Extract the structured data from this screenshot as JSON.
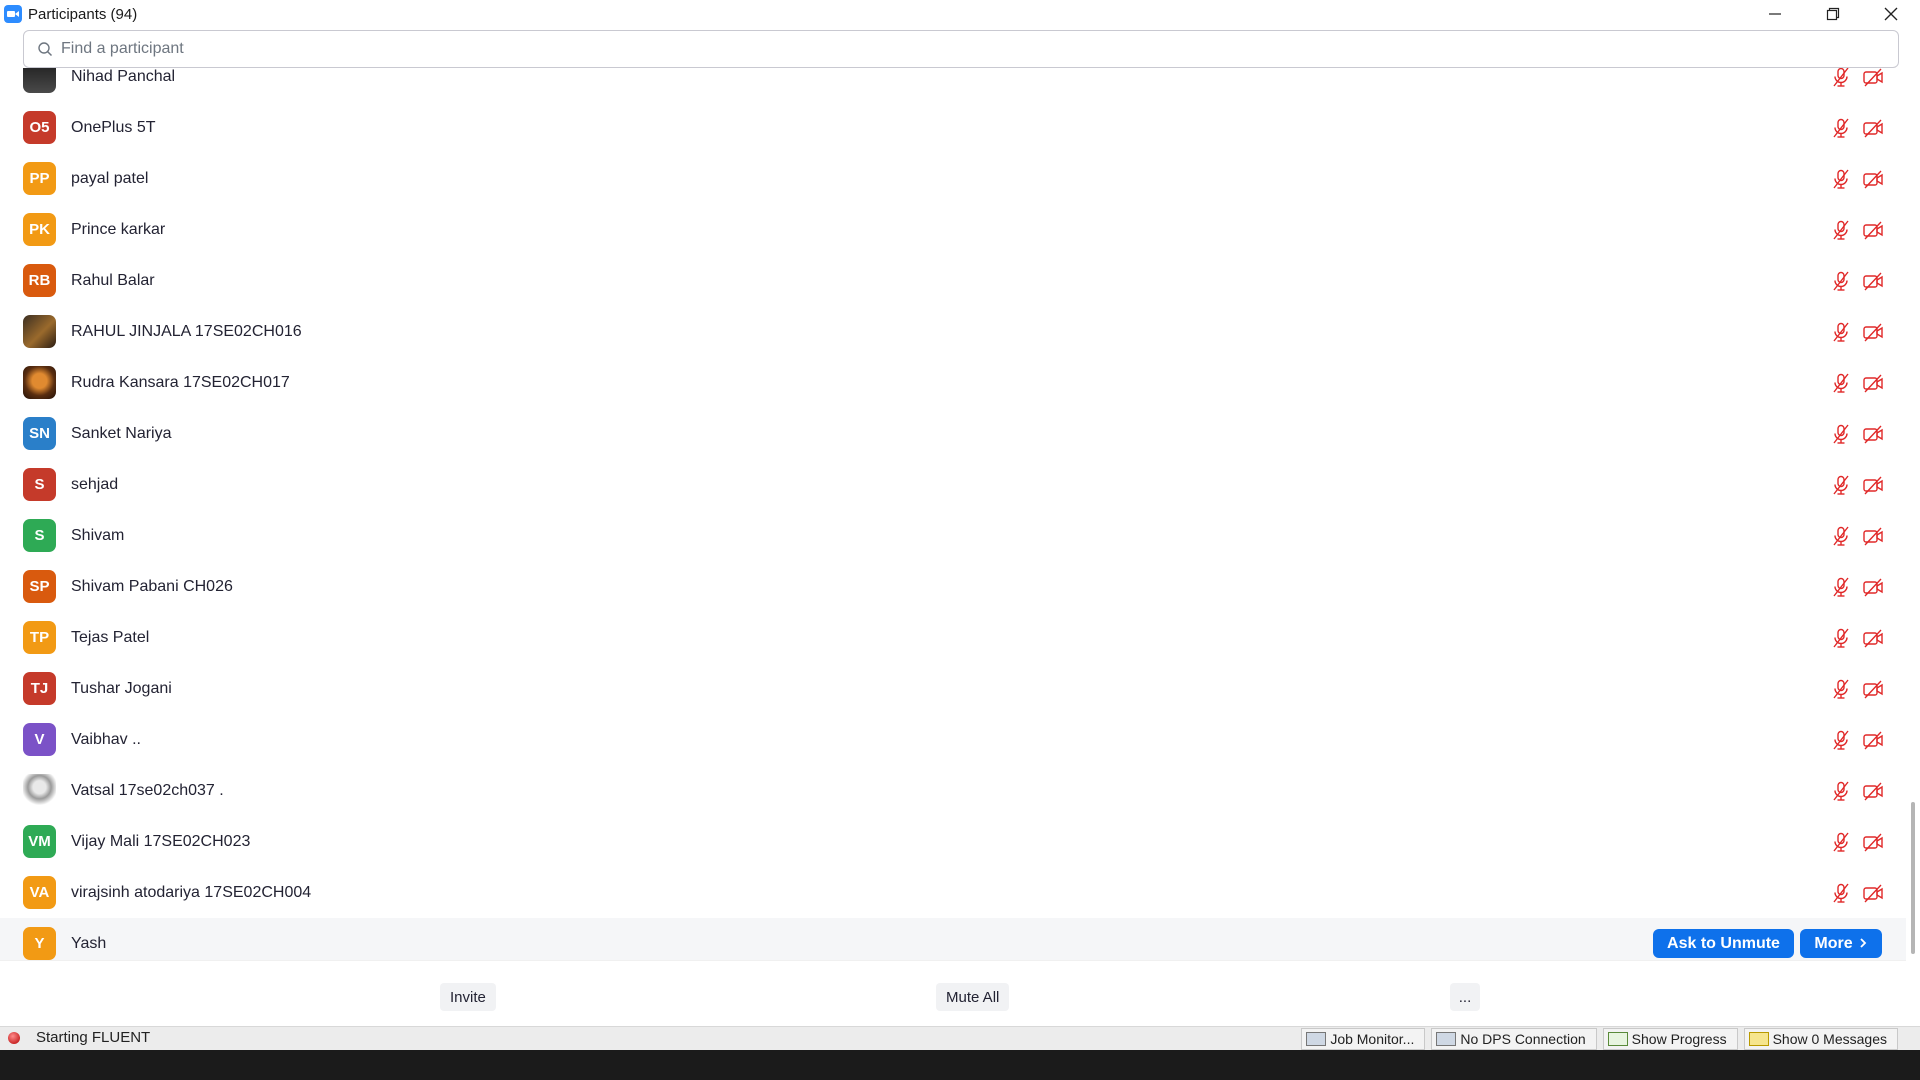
{
  "window": {
    "title": "Participants (94)"
  },
  "search": {
    "placeholder": "Find a participant"
  },
  "participants": [
    {
      "initials": "",
      "name": "Nihad Panchal",
      "color": "#2b2b2b",
      "photo": "photo4"
    },
    {
      "initials": "O5",
      "name": "OnePlus 5T",
      "color": "#c53a2a"
    },
    {
      "initials": "PP",
      "name": "payal patel",
      "color": "#f29a14"
    },
    {
      "initials": "PK",
      "name": "Prince karkar",
      "color": "#f29a14"
    },
    {
      "initials": "RB",
      "name": "Rahul Balar",
      "color": "#d95a0e"
    },
    {
      "initials": "",
      "name": "RAHUL JINJALA 17SE02CH016",
      "color": "#5a4020",
      "photo": "photo"
    },
    {
      "initials": "",
      "name": "Rudra Kansara 17SE02CH017",
      "color": "#5a2e10",
      "photo": "photo2"
    },
    {
      "initials": "SN",
      "name": "Sanket Nariya",
      "color": "#2a7fc9"
    },
    {
      "initials": "S",
      "name": "sehjad",
      "color": "#c53a2a"
    },
    {
      "initials": "S",
      "name": "Shivam",
      "color": "#2eaa55"
    },
    {
      "initials": "SP",
      "name": "Shivam Pabani CH026",
      "color": "#d95a0e"
    },
    {
      "initials": "TP",
      "name": "Tejas Patel",
      "color": "#f29a14"
    },
    {
      "initials": "TJ",
      "name": "Tushar Jogani",
      "color": "#c53a2a"
    },
    {
      "initials": "V",
      "name": "Vaibhav ..",
      "color": "#7b52c7"
    },
    {
      "initials": "",
      "name": "Vatsal 17se02ch037 .",
      "color": "#aaaaaa",
      "photo": "photo3"
    },
    {
      "initials": "VM",
      "name": "Vijay Mali 17SE02CH023",
      "color": "#2eaa55"
    },
    {
      "initials": "VA",
      "name": "virajsinh atodariya 17SE02CH004",
      "color": "#f29a14"
    },
    {
      "initials": "Y",
      "name": "Yash",
      "color": "#f29a14",
      "hover": true
    }
  ],
  "row_actions": {
    "ask_to_unmute": "Ask to Unmute",
    "more": "More"
  },
  "footer": {
    "invite": "Invite",
    "mute_all": "Mute All",
    "ellipsis": "..."
  },
  "status_strip": {
    "left_text": "Starting FLUENT",
    "items": [
      "Job Monitor...",
      "No DPS Connection",
      "Show Progress",
      "Show 0 Messages"
    ]
  },
  "colors": {
    "accent": "#0e71eb",
    "muted_red": "#e02828"
  }
}
